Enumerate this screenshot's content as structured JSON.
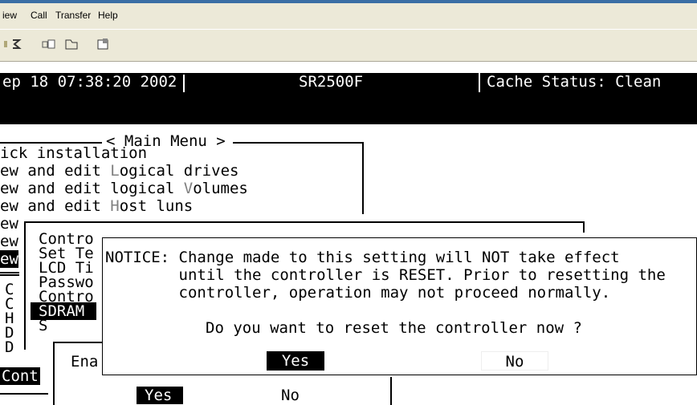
{
  "menubar": {
    "items": [
      "iew",
      "Call",
      "Transfer",
      "Help"
    ]
  },
  "toolbar": {
    "icons": [
      "phone-icon",
      "connect-icon",
      "disconnect-icon",
      "properties-icon"
    ]
  },
  "status": {
    "datetime": "ep 18 07:38:20 2002",
    "model": "SR2500F",
    "cache": "Cache Status: Clean"
  },
  "main_menu": {
    "title": "< Main Menu >",
    "items": [
      {
        "pre": "ick installation",
        "hot": "",
        "post": ""
      },
      {
        "pre": "ew and edit ",
        "hot": "L",
        "post": "ogical drives"
      },
      {
        "pre": "ew and edit logical ",
        "hot": "V",
        "post": "olumes"
      },
      {
        "pre": "ew and edit ",
        "hot": "H",
        "post": "ost luns"
      }
    ],
    "left_fragments": [
      "ew",
      "ew",
      "ew"
    ],
    "left_letters": [
      "C",
      "C",
      "H",
      "D",
      "D"
    ],
    "bottom_left": "Cont"
  },
  "submenu": {
    "items": [
      "Contro",
      "Set Te",
      "LCD Ti",
      "Passwo",
      "Contro",
      "SDRAM",
      "S"
    ],
    "selected_index": 5
  },
  "enable_dialog": {
    "label": "Ena",
    "yes": "Yes",
    "no": "No"
  },
  "notice": {
    "line1": "NOTICE: Change made to this setting will NOT take effect",
    "line2": "        until the controller is RESET. Prior to resetting the",
    "line3": "        controller, operation may not proceed normally.",
    "question": "Do you want to reset the controller now ?",
    "yes": "Yes",
    "no": "No"
  }
}
